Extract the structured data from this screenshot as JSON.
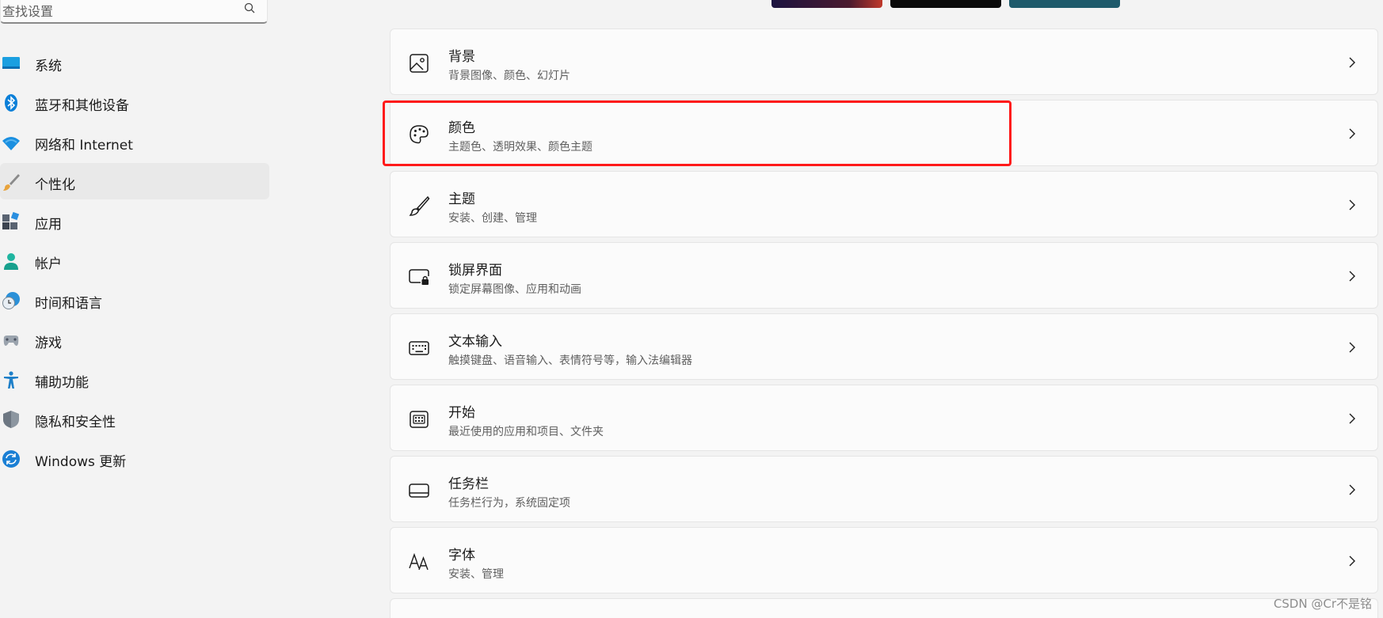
{
  "search": {
    "placeholder": "查找设置"
  },
  "sidebar": {
    "items": [
      {
        "label": "系统",
        "icon": "monitor-icon"
      },
      {
        "label": "蓝牙和其他设备",
        "icon": "bluetooth-icon"
      },
      {
        "label": "网络和 Internet",
        "icon": "wifi-icon"
      },
      {
        "label": "个性化",
        "icon": "brush-icon",
        "active": true
      },
      {
        "label": "应用",
        "icon": "apps-icon"
      },
      {
        "label": "帐户",
        "icon": "person-icon"
      },
      {
        "label": "时间和语言",
        "icon": "globe-clock-icon"
      },
      {
        "label": "游戏",
        "icon": "gamepad-icon"
      },
      {
        "label": "辅助功能",
        "icon": "accessibility-icon"
      },
      {
        "label": "隐私和安全性",
        "icon": "shield-icon"
      },
      {
        "label": "Windows 更新",
        "icon": "update-icon"
      }
    ]
  },
  "cards": [
    {
      "title": "背景",
      "subtitle": "背景图像、颜色、幻灯片",
      "icon": "image-icon"
    },
    {
      "title": "颜色",
      "subtitle": "主题色、透明效果、颜色主题",
      "icon": "palette-icon",
      "highlighted": true
    },
    {
      "title": "主题",
      "subtitle": "安装、创建、管理",
      "icon": "brush-icon"
    },
    {
      "title": "锁屏界面",
      "subtitle": "锁定屏幕图像、应用和动画",
      "icon": "lock-screen-icon"
    },
    {
      "title": "文本输入",
      "subtitle": "触摸键盘、语音输入、表情符号等，输入法编辑器",
      "icon": "keyboard-icon"
    },
    {
      "title": "开始",
      "subtitle": "最近使用的应用和项目、文件夹",
      "icon": "start-icon"
    },
    {
      "title": "任务栏",
      "subtitle": "任务栏行为，系统固定项",
      "icon": "taskbar-icon"
    },
    {
      "title": "字体",
      "subtitle": "安装、管理",
      "icon": "font-icon"
    }
  ],
  "colors": {
    "accent": "#0067c0",
    "highlight": "#ff1a1a"
  },
  "watermark": "CSDN @Cr不是铭"
}
